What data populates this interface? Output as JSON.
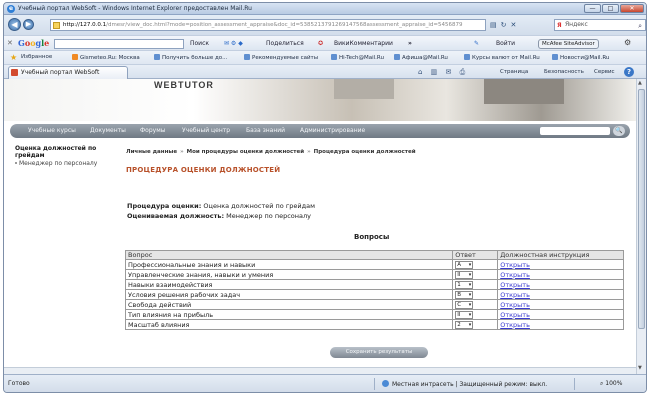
{
  "window": {
    "title": "Учебный портал WebSoft - Windows Internet Explorer предоставлен Mail.Ru",
    "min_label": "—",
    "max_label": "□",
    "close_label": "✕"
  },
  "address": {
    "url_host": "http://127.0.0.1",
    "url_path": "/dmesr/view_doc.html?mode=position_assessment_appraise&doc_id=5385213791269147568assessment_appraise_id=5456879",
    "search_engine": "Я",
    "search_text": "Яндекс"
  },
  "google_toolbar": {
    "logo": "Google",
    "search_label": "Поиск",
    "share_label": "Поделиться",
    "wiki_label": "ВикиКомментарии",
    "more_label": "»",
    "signin_label": "Войти",
    "mcafee_label": "McAfee SiteAdvisor"
  },
  "favorites": {
    "label": "Избранное",
    "items": [
      "Gismeteo.Ru: Москва",
      "Получить больше до...",
      "Рекомендуемые сайты",
      "Hi-Tech@Mail.Ru",
      "Афиша@Mail.Ru",
      "Курсы валют от Mail.Ru",
      "Новости@Mail.Ru"
    ]
  },
  "commandbar": {
    "tab_label": "Учебный портал WebSoft",
    "page_menu": "Страница",
    "safety_menu": "Безопасность",
    "service_menu": "Сервис",
    "help_icon": "?"
  },
  "portal": {
    "logo": "WEBTUTOR",
    "nav": [
      "Учебные курсы",
      "Документы",
      "Форумы",
      "Учебный центр",
      "База знаний",
      "Администрирование"
    ],
    "search_button": "🔍",
    "sidebar_title": "Оценка должностей по грейдам",
    "sidebar_link": "Менеджер по персоналу",
    "breadcrumb": [
      "Личные данные",
      "Мои процедуры оценки должностей",
      "Процедура оценки должностей"
    ],
    "breadcrumb_sep": "»",
    "page_title": "ПРОЦЕДУРА ОЦЕНКИ ДОЛЖНОСТЕЙ",
    "procedure_label": "Процедура оценки:",
    "procedure_value": "Оценка должностей по грейдам",
    "position_label": "Оцениваемая должность:",
    "position_value": "Менеджер по персоналу",
    "questions_heading": "Вопросы",
    "table_headers": [
      "Вопрос",
      "Ответ",
      "Должностная инструкция"
    ],
    "rows": [
      {
        "question": "Профессиональные знания и навыки",
        "answer": "A",
        "link": "Открыть"
      },
      {
        "question": "Управленческие знания, навыки и умения",
        "answer": "II",
        "link": "Открыть"
      },
      {
        "question": "Навыки взаимодействия",
        "answer": "1",
        "link": "Открыть"
      },
      {
        "question": "Условия решения рабочих задач",
        "answer": "B",
        "link": "Открыть"
      },
      {
        "question": "Свобода действий",
        "answer": "C",
        "link": "Открыть"
      },
      {
        "question": "Тип влияния на прибыль",
        "answer": "II",
        "link": "Открыть"
      },
      {
        "question": "Масштаб влияния",
        "answer": "2",
        "link": "Открыть"
      }
    ],
    "save_button": "Сохранить результаты"
  },
  "status": {
    "text": "Готово",
    "zone": "Местная интрасеть | Защищенный режим: выкл.",
    "zoom": "100%"
  }
}
